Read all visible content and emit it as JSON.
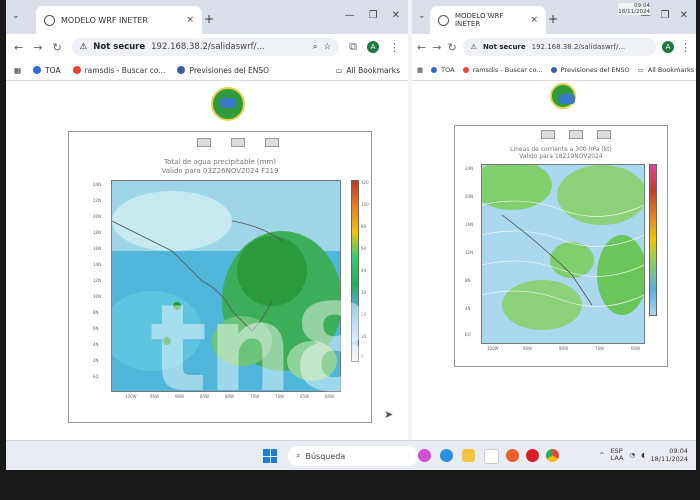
{
  "left_window": {
    "tab_title": "MODELO WRF INETER",
    "tab_close": "×",
    "new_tab": "+",
    "window_controls": [
      "—",
      "❐",
      "✕"
    ],
    "security_label": "Not secure",
    "url": "192.168.38.2/salidaswrf/...",
    "profile_initial": "A",
    "bookmarks": [
      {
        "label": "TOA",
        "icon": "globe-icon",
        "color": "#2b6cd4"
      },
      {
        "label": "ramsdis - Buscar co...",
        "icon": "google-icon",
        "color": "#ea4335"
      },
      {
        "label": "Previsiones del ENSO",
        "icon": "site-icon",
        "color": "#3b5ba5"
      }
    ],
    "all_bookmarks": "All Bookmarks",
    "map_title_line1": "Total de agua precipitable (mm)",
    "map_title_line2": "Valido para 03Z26NOV2024 F219",
    "y_ticks": [
      "24N",
      "22N",
      "20N",
      "18N",
      "16N",
      "14N",
      "12N",
      "10N",
      "8N",
      "6N",
      "4N",
      "2N",
      "EQ"
    ],
    "x_ticks": [
      "100W",
      "95W",
      "90W",
      "85W",
      "80W",
      "75W",
      "70W",
      "65W",
      "60W"
    ],
    "colorbar_ticks": [
      "120",
      "100",
      "80",
      "60",
      "40",
      "30",
      "20",
      "10",
      "0"
    ]
  },
  "right_window": {
    "tab_title": "MODELO WRF INETER",
    "tab_close": "×",
    "new_tab": "+",
    "window_controls": [
      "—",
      "❐",
      "✕"
    ],
    "security_label": "Not secure",
    "url": "192.168.38.2/salidaswrf/...",
    "profile_initial": "A",
    "bookmarks": [
      {
        "label": "TOA",
        "icon": "globe-icon",
        "color": "#2b6cd4"
      },
      {
        "label": "ramsdis - Buscar co...",
        "icon": "google-icon",
        "color": "#ea4335"
      },
      {
        "label": "Previsiones del ENSO",
        "icon": "site-icon",
        "color": "#3b5ba5"
      }
    ],
    "all_bookmarks": "All Bookmarks",
    "map_title_line1": "Lineas de corriente a 300 hPa (kt)",
    "map_title_line2": "Valido para 18Z19NOV2024",
    "y_ticks": [
      "24N",
      "20N",
      "16N",
      "12N",
      "8N",
      "4N",
      "EQ"
    ],
    "x_ticks": [
      "100W",
      "90W",
      "80W",
      "70W",
      "60W"
    ]
  },
  "taskbar": {
    "search_placeholder": "Búsqueda",
    "lang_line1": "ESP",
    "lang_line2": "LAA",
    "time": "09:04",
    "date": "18/11/2024"
  },
  "top_clock": {
    "time": "09:04",
    "date": "18/11/2024"
  },
  "watermark": "tn8"
}
